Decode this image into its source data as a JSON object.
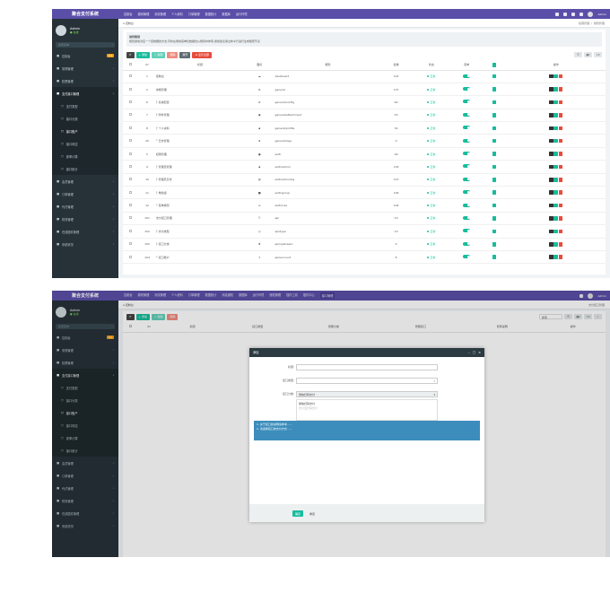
{
  "app": {
    "title": "聚合支付系统",
    "nav": [
      "控制台",
      "模块管理",
      "测试管理",
      "个人资料",
      "订单管理",
      "数据统计",
      "数据库",
      "运行环境"
    ],
    "nav2": [
      "控制台",
      "模块管理",
      "测试管理",
      "个人资料",
      "订单管理",
      "数据统计",
      "消息通知",
      "数据库",
      "运行环境",
      "授权管理",
      "插件工具",
      "插件中心",
      "接口管理"
    ],
    "nav2_active_index": 12,
    "user_name": "Admin"
  },
  "sidebar": {
    "user": "Admin",
    "status": "● 在线",
    "search_placeholder": "搜索菜单",
    "items": [
      {
        "label": "控制台",
        "badge": "hot",
        "kind": "top",
        "state": ""
      },
      {
        "label": "常规管理",
        "kind": "top",
        "state": ""
      },
      {
        "label": "权限管理",
        "kind": "top",
        "state": ""
      },
      {
        "label": "支付接口管理",
        "kind": "top",
        "state": "active"
      },
      {
        "label": "支付类型",
        "kind": "sub",
        "state": ""
      },
      {
        "label": "接口分类",
        "kind": "sub",
        "state": ""
      },
      {
        "label": "接口账户",
        "kind": "sub",
        "state": "hl"
      },
      {
        "label": "接口风控",
        "kind": "sub",
        "state": ""
      },
      {
        "label": "费率计算",
        "kind": "sub",
        "state": ""
      },
      {
        "label": "接口统计",
        "kind": "sub",
        "state": ""
      },
      {
        "label": "会员管理",
        "kind": "top",
        "state": ""
      },
      {
        "label": "订单管理",
        "kind": "top",
        "state": ""
      },
      {
        "label": "代付管理",
        "kind": "top",
        "state": ""
      },
      {
        "label": "财务管理",
        "kind": "top",
        "state": ""
      },
      {
        "label": "在线插件管理",
        "kind": "top",
        "state": ""
      },
      {
        "label": "系统状况",
        "kind": "top",
        "state": ""
      }
    ]
  },
  "page1": {
    "breadcrumb": "控制台",
    "breadcrumb_right": [
      "权限管理",
      "规则管理"
    ],
    "tip_title": "规则管理",
    "tip_text": "规则通常对应一个控制器的方法,同时左侧的菜单栏数据也从规则中体现,通常建议通过命令行进行生成规则节点",
    "toolbar": {
      "add": "+ 添加",
      "edit": "✓ 编辑",
      "del": "删除",
      "expand": "展开",
      "toggle_menu": "≡ 显示全部"
    },
    "columns": [
      "",
      "ID",
      "标题",
      "图标",
      "规则",
      "权重",
      "状态",
      "菜单",
      "",
      "操作"
    ],
    "rows": [
      {
        "id": "1",
        "title": "控制台",
        "icon": "☁",
        "rule": "dashboard",
        "weight": "143"
      },
      {
        "id": "2",
        "title": "常规管理",
        "icon": "⚙",
        "rule": "general",
        "weight": "137"
      },
      {
        "id": "6",
        "title": "├ 系统配置",
        "icon": "⚙",
        "rule": "general/config",
        "weight": "60"
      },
      {
        "id": "7",
        "title": "├ 附件管理",
        "icon": "▣",
        "rule": "general/attachment",
        "weight": "53"
      },
      {
        "id": "8",
        "title": "├ 个人资料",
        "icon": "♟",
        "rule": "general/profile",
        "weight": "34"
      },
      {
        "id": "20",
        "title": "└ 日志管理",
        "icon": "♠",
        "rule": "general/logs",
        "weight": "0"
      },
      {
        "id": "5",
        "title": "权限管理",
        "icon": "●",
        "rule": "auth",
        "weight": "99"
      },
      {
        "id": "9",
        "title": "├ 管理员管理",
        "icon": "♟",
        "rule": "auth/admin",
        "weight": "118"
      },
      {
        "id": "10",
        "title": "├ 管理员日志",
        "icon": "▤",
        "rule": "auth/adminlog",
        "weight": "113"
      },
      {
        "id": "11",
        "title": "├ 角色组",
        "icon": "■",
        "rule": "auth/group",
        "weight": "109"
      },
      {
        "id": "12",
        "title": "└ 菜单规则",
        "icon": "≡",
        "rule": "auth/rule",
        "weight": "104"
      },
      {
        "id": "101",
        "title": "支付接口管理",
        "icon": "☷",
        "rule": "api",
        "weight": "10"
      },
      {
        "id": "102",
        "title": "├ 支付类型",
        "icon": "◎",
        "rule": "api/type",
        "weight": "10"
      },
      {
        "id": "105",
        "title": "├ 接口分类",
        "icon": "♣",
        "rule": "api/upstream",
        "weight": "9"
      },
      {
        "id": "104",
        "title": "└ 接口账户",
        "icon": "✦",
        "rule": "api/account",
        "weight": "8"
      }
    ],
    "status_label": "正常"
  },
  "page2": {
    "breadcrumb": "控制台",
    "breadcrumb_right": "支付接口管理",
    "toolbar": {
      "add": "+ 添加",
      "edit": "✓ 编辑",
      "del": "删除"
    },
    "search_placeholder": "搜索",
    "columns": [
      "",
      "ID",
      "标题",
      "接口类型",
      "所属分类",
      "所属接口",
      "费率说明",
      "操作"
    ],
    "modal": {
      "title": "添加",
      "fields": [
        {
          "label": "标题:",
          "value": ""
        },
        {
          "label": "接口类型:",
          "value": ""
        },
        {
          "label": "接口分类:",
          "value": "微信扫码支付"
        }
      ],
      "dropdown_options": [
        "微信扫码支付",
        "支付宝扫码支付"
      ],
      "info_lines": [
        "1. 关于接口的说明请参考……",
        "2. 请选择接口的支付方式……"
      ],
      "ok": "确定",
      "reset": "重置"
    }
  },
  "colors": {
    "topbar": "#5a4fa8",
    "sidebar": "#263238",
    "success": "#18bc9c",
    "danger": "#e74c3c",
    "info": "#3c8dbc"
  }
}
